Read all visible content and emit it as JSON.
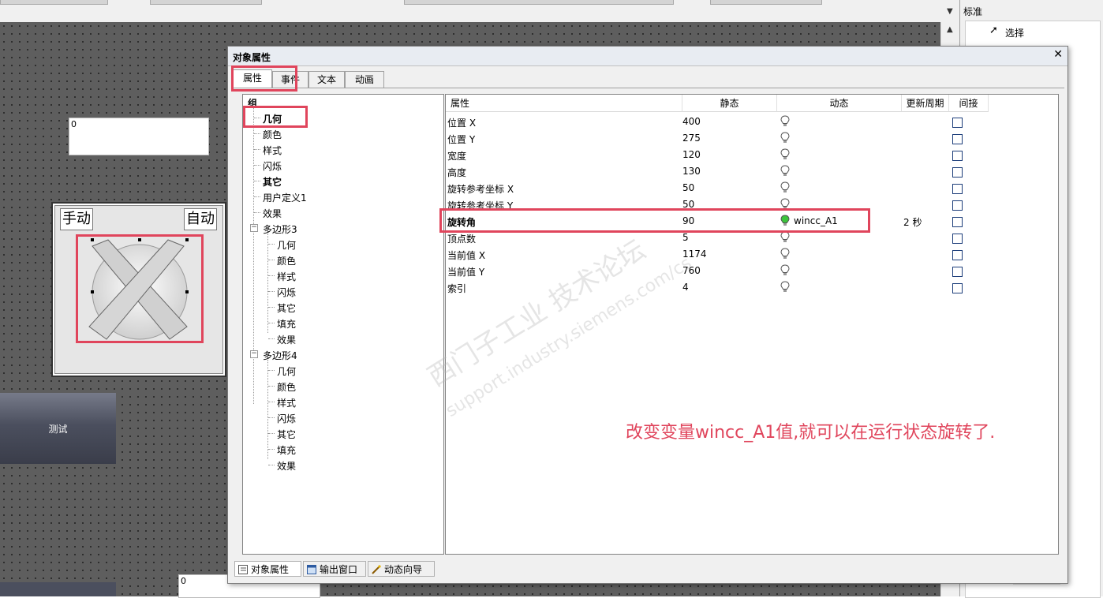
{
  "canvas": {
    "io_field_top_value": "0",
    "io_field_bottom_value": "0",
    "manual_label": "手动",
    "auto_label": "自动",
    "test_button_label": "测试"
  },
  "right_panel": {
    "header": "标准",
    "items": [
      "选择"
    ]
  },
  "dialog": {
    "title": "对象属性",
    "close": "✕",
    "tabs": [
      "属性",
      "事件",
      "文本",
      "动画"
    ],
    "tree": {
      "root": "组",
      "group_items": [
        "几何",
        "颜色",
        "样式",
        "闪烁",
        "其它",
        "用户定义1",
        "效果"
      ],
      "polygon3": {
        "label": "多边形3",
        "children": [
          "几何",
          "颜色",
          "样式",
          "闪烁",
          "其它",
          "填充",
          "效果"
        ]
      },
      "polygon4": {
        "label": "多边形4",
        "children": [
          "几何",
          "颜色",
          "样式",
          "闪烁",
          "其它",
          "填充",
          "效果"
        ]
      }
    },
    "grid": {
      "headers": [
        "属性",
        "静态",
        "动态",
        "更新周期",
        "间接"
      ],
      "rows": [
        {
          "prop": "位置 X",
          "static": "400",
          "dynamic": "",
          "cycle": ""
        },
        {
          "prop": "位置 Y",
          "static": "275",
          "dynamic": "",
          "cycle": ""
        },
        {
          "prop": "宽度",
          "static": "120",
          "dynamic": "",
          "cycle": ""
        },
        {
          "prop": "高度",
          "static": "130",
          "dynamic": "",
          "cycle": ""
        },
        {
          "prop": "旋转参考坐标 X",
          "static": "50",
          "dynamic": "",
          "cycle": ""
        },
        {
          "prop": "旋转参考坐标 Y",
          "static": "50",
          "dynamic": "",
          "cycle": ""
        },
        {
          "prop": "旋转角",
          "static": "90",
          "dynamic": "wincc_A1",
          "cycle": "2 秒"
        },
        {
          "prop": "顶点数",
          "static": "5",
          "dynamic": "",
          "cycle": ""
        },
        {
          "prop": "当前值 X",
          "static": "1174",
          "dynamic": "",
          "cycle": ""
        },
        {
          "prop": "当前值 Y",
          "static": "760",
          "dynamic": "",
          "cycle": ""
        },
        {
          "prop": "索引",
          "static": "4",
          "dynamic": "",
          "cycle": ""
        }
      ]
    },
    "status_tabs": [
      "对象属性",
      "输出窗口",
      "动态向导"
    ]
  },
  "annotation": "改变变量wincc_A1值,就可以在运行状态旋转了.",
  "watermark": {
    "line1": "西门子工业  技术论坛",
    "line2": "support.industry.siemens.com/cs"
  },
  "colors": {
    "highlight_red": "#e0455c",
    "active_bulb": "#3cc43c"
  }
}
